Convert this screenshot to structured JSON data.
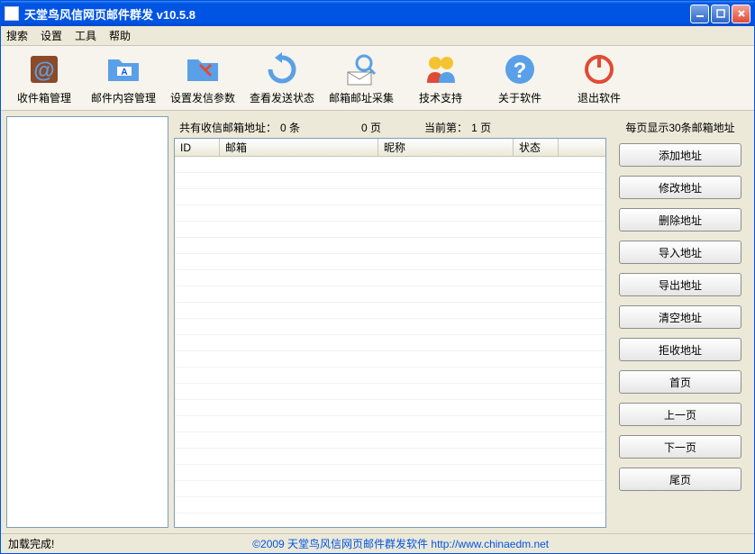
{
  "window": {
    "title": "天堂鸟风信网页邮件群发  v10.5.8"
  },
  "menu": {
    "search": "搜索",
    "settings": "设置",
    "tools": "工具",
    "help": "帮助"
  },
  "toolbar": {
    "inbox_mgmt": "收件箱管理",
    "content_mgmt": "邮件内容管理",
    "send_params": "设置发信参数",
    "send_status": "查看发送状态",
    "addr_collect": "邮箱邮址采集",
    "tech_support": "技术支持",
    "about": "关于软件",
    "exit": "退出软件"
  },
  "stats": {
    "total_label": "共有收信邮箱地址：",
    "total_count": "0 条",
    "pages_count": "0 页",
    "current_label": "当前第：",
    "current_page": "1 页"
  },
  "table": {
    "col_id": "ID",
    "col_email": "邮箱",
    "col_nick": "昵称",
    "col_status": "状态"
  },
  "right": {
    "per_page": "每页显示30条邮箱地址",
    "add": "添加地址",
    "edit": "修改地址",
    "delete": "删除地址",
    "import": "导入地址",
    "export": "导出地址",
    "clear": "清空地址",
    "reject": "拒收地址",
    "first": "首页",
    "prev": "上一页",
    "next": "下一页",
    "last": "尾页"
  },
  "status": {
    "loaded": "加载完成!",
    "copyright": "©2009 天堂鸟风信网页邮件群发软件 http://www.chinaedm.net"
  }
}
